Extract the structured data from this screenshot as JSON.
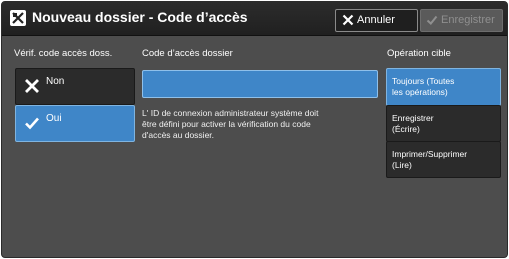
{
  "window": {
    "title": "Nouveau dossier - Code d’accès"
  },
  "toolbar": {
    "cancel_label": "Annuler",
    "save_label": "Enregistrer"
  },
  "verify": {
    "heading": "Vérif. code accès doss.",
    "options": [
      {
        "label": "Non",
        "icon": "x-icon",
        "selected": false
      },
      {
        "label": "Oui",
        "icon": "checkmark-icon",
        "selected": true
      }
    ]
  },
  "passcode": {
    "heading": "Code d’accès dossier",
    "value": "",
    "info_lines": [
      "L' ID de connexion administrateur système doit",
      "être défini pour activer la vérification du code",
      "d'accès au dossier."
    ]
  },
  "target": {
    "heading": "Opération cible",
    "options": [
      {
        "lines": [
          "Toujours (Toutes",
          "les opérations)"
        ],
        "selected": true
      },
      {
        "lines": [
          "Enregistrer",
          "(Écrire)"
        ],
        "selected": false
      },
      {
        "lines": [
          "Imprimer/Supprimer",
          "(Lire)"
        ],
        "selected": false
      }
    ]
  },
  "colors": {
    "selected_blue": "#3f86c8",
    "panel_gray": "#4d4d4d",
    "unselected_dark": "#2b2b2b",
    "title_bar": "#222222"
  }
}
